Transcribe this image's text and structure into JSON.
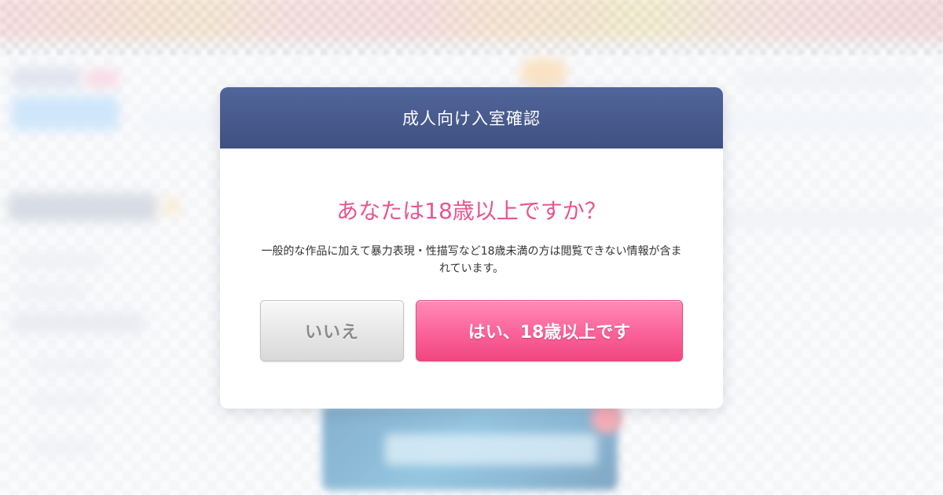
{
  "modal": {
    "title": "成人向け入室確認",
    "question": "あなたは18歳以上ですか？",
    "notice": "一般的な作品に加えて暴力表現・性描写など18歳未満の方は閲覧できない情報が含まれています。",
    "buttons": {
      "no_label": "いいえ",
      "yes_label": "はい、18歳以上です"
    }
  },
  "colors": {
    "header_bg": "#46578a",
    "question_text": "#e9558f",
    "yes_button": "#fb659b",
    "no_button": "#e6e6e6"
  }
}
